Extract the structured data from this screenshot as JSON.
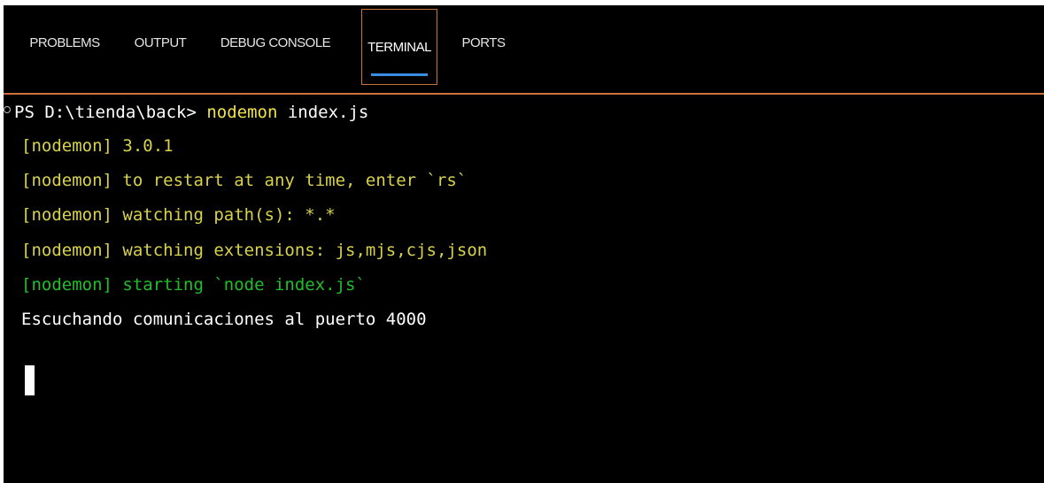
{
  "tabs": [
    {
      "label": "PROBLEMS"
    },
    {
      "label": "OUTPUT"
    },
    {
      "label": "DEBUG CONSOLE"
    },
    {
      "label": "TERMINAL",
      "active": true
    },
    {
      "label": "PORTS"
    }
  ],
  "terminal": {
    "prompt": {
      "prefix": "PS D:\\tienda\\back> ",
      "command": "nodemon",
      "args": " index.js"
    },
    "lines": [
      "[nodemon] 3.0.1",
      "[nodemon] to restart at any time, enter `rs`",
      "[nodemon] watching path(s): *.*",
      "[nodemon] watching extensions: js,mjs,cjs,json",
      "[nodemon] starting `node index.js`",
      "Escuchando comunicaciones al puerto 4000"
    ]
  },
  "colors": {
    "accent": "#c9743a",
    "active_underline": "#3a8ee0",
    "command_yellow": "#f2e34a",
    "nodemon_yellow": "#d8d24a",
    "nodemon_green": "#1fbf2a",
    "text_white": "#ffffff",
    "background": "#000000"
  }
}
